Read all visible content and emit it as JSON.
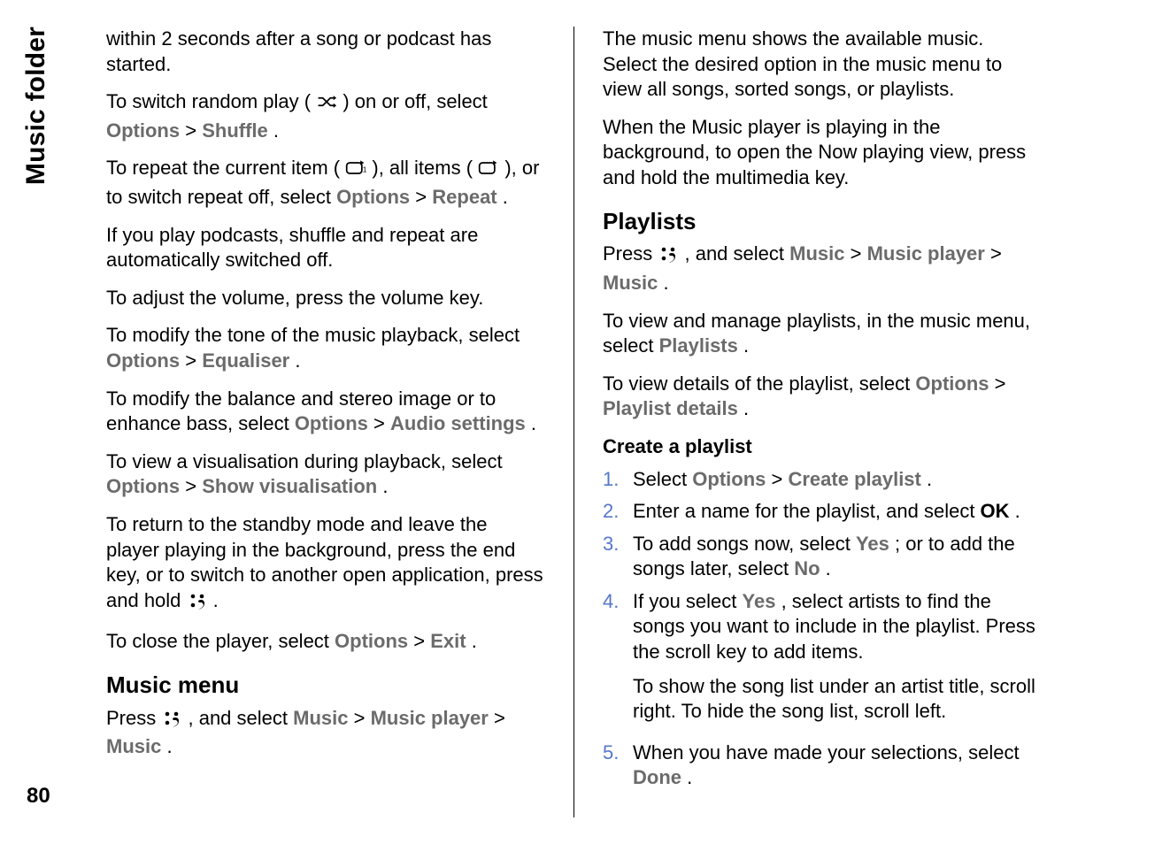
{
  "side_tab": "Music folder",
  "page_number": "80",
  "left": {
    "p1": "within 2 seconds after a song or podcast has started.",
    "p2_a": "To switch random play (",
    "p2_b": ") on or off, select ",
    "p2_opt": "Options",
    "p2_sep": " > ",
    "p2_shuffle": "Shuffle",
    "p2_end": ".",
    "p3_a": "To repeat the current item (",
    "p3_b": "), all items (",
    "p3_c": "), or to switch repeat off, select ",
    "p3_opt": "Options",
    "p3_sep": " > ",
    "p3_repeat": "Repeat",
    "p3_end": ".",
    "p4": "If you play podcasts, shuffle and repeat are automatically switched off.",
    "p5": "To adjust the volume, press the volume key.",
    "p6_a": "To modify the tone of the music playback, select ",
    "p6_opt": "Options",
    "p6_sep": " > ",
    "p6_eq": "Equaliser",
    "p6_end": ".",
    "p7_a": "To modify the balance and stereo image or to enhance bass, select ",
    "p7_opt": "Options",
    "p7_sep": " > ",
    "p7_audio": "Audio settings",
    "p7_end": ".",
    "p8_a": "To view a visualisation during playback, select ",
    "p8_opt": "Options",
    "p8_sep": " > ",
    "p8_vis": "Show visualisation",
    "p8_end": ".",
    "p9_a": "To return to the standby mode and leave the player playing in the background, press the end key, or to switch to another open application, press and hold ",
    "p9_end": " .",
    "p10_a": "To close the player, select ",
    "p10_opt": "Options",
    "p10_sep": " > ",
    "p10_exit": "Exit",
    "p10_end": ".",
    "h_music_menu": "Music menu",
    "p11_a": "Press ",
    "p11_b": " , and select ",
    "p11_music": "Music",
    "p11_sep1": " > ",
    "p11_mp": "Music player",
    "p11_sep2": " > ",
    "p11_music2": "Music",
    "p11_end": "."
  },
  "right": {
    "p1": "The music menu shows the available music. Select the desired option in the music menu to view all songs, sorted songs, or playlists.",
    "p2": "When the Music player is playing in the background, to open the Now playing view, press and hold the multimedia key.",
    "h_playlists": "Playlists",
    "p3_a": "Press ",
    "p3_b": " , and select ",
    "p3_music": "Music",
    "p3_sep1": " > ",
    "p3_mp": "Music player",
    "p3_sep2": " > ",
    "p3_music2": "Music",
    "p3_end": ".",
    "p4_a": "To view and manage playlists, in the music menu, select ",
    "p4_play": "Playlists",
    "p4_end": ".",
    "p5_a": "To view details of the playlist, select ",
    "p5_opt": "Options",
    "p5_sep": " > ",
    "p5_pd": "Playlist details",
    "p5_end": ".",
    "h_create": "Create a playlist",
    "steps": {
      "1": {
        "a": "Select ",
        "opt": "Options",
        "sep": " > ",
        "cp": "Create playlist",
        "end": "."
      },
      "2": {
        "a": "Enter a name for the playlist, and select ",
        "ok": "OK",
        "end": "."
      },
      "3": {
        "a": "To add songs now, select ",
        "yes": "Yes",
        "b": "; or to add the songs later, select ",
        "no": "No",
        "end": "."
      },
      "4": {
        "a": "If you select ",
        "yes": "Yes",
        "b": ", select artists to find the songs you want to include in the playlist. Press the scroll key to add items.",
        "p2": "To show the song list under an artist title, scroll right. To hide the song list, scroll left."
      },
      "5": {
        "a": "When you have made your selections, select ",
        "done": "Done",
        "end": "."
      }
    },
    "nums": {
      "1": "1.",
      "2": "2.",
      "3": "3.",
      "4": "4.",
      "5": "5."
    }
  }
}
